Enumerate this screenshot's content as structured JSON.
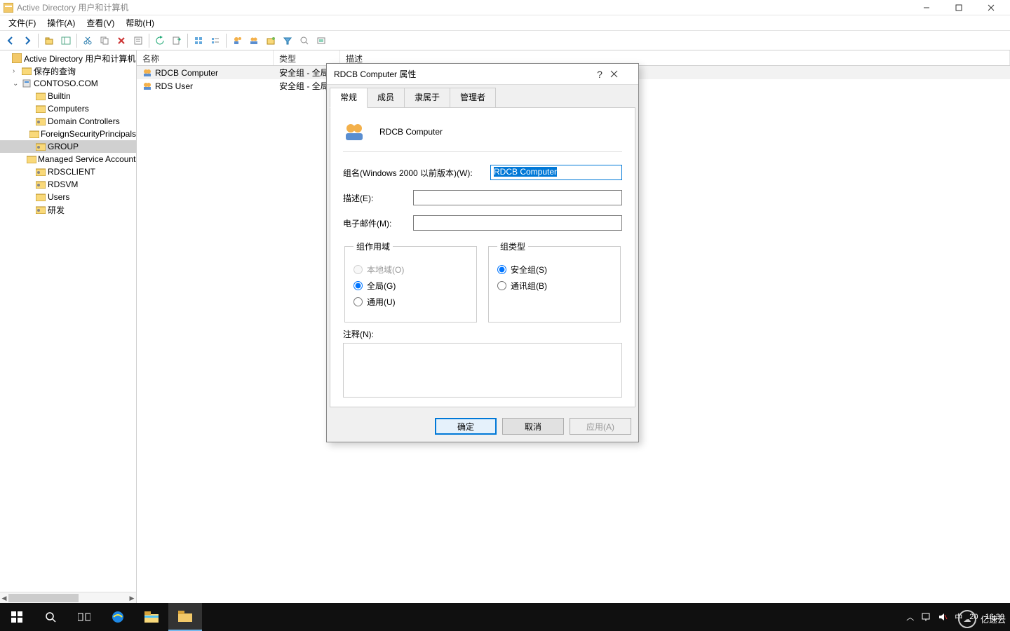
{
  "window": {
    "title": "Active Directory 用户和计算机",
    "min_tooltip": "最小化",
    "max_tooltip": "最大化",
    "close_tooltip": "关闭"
  },
  "menu": {
    "file": "文件(F)",
    "action": "操作(A)",
    "view": "查看(V)",
    "help": "帮助(H)"
  },
  "toolbar_icons": {
    "back": "←",
    "forward": "→",
    "up": "folder-up",
    "show_pane": "pane",
    "cut": "✂",
    "copy": "copy",
    "delete": "✖",
    "props": "props",
    "refresh": "⟳",
    "export": "export",
    "grid1": "g1",
    "grid2": "g2",
    "user_add": "ua",
    "group_add": "ga",
    "ou_add": "oa",
    "filter": "filter",
    "find": "find",
    "sort": "sort"
  },
  "tree": {
    "root": "Active Directory 用户和计算机",
    "saved_queries": "保存的查询",
    "domain": "CONTOSO.COM",
    "nodes": [
      {
        "label": "Builtin"
      },
      {
        "label": "Computers"
      },
      {
        "label": "Domain Controllers"
      },
      {
        "label": "ForeignSecurityPrincipals"
      },
      {
        "label": "GROUP",
        "selected": true
      },
      {
        "label": "Managed Service Accounts"
      },
      {
        "label": "RDSCLIENT"
      },
      {
        "label": "RDSVM"
      },
      {
        "label": "Users"
      },
      {
        "label": "研发"
      }
    ]
  },
  "list": {
    "headers": {
      "name": "名称",
      "type": "类型",
      "desc": "描述"
    },
    "rows": [
      {
        "name": "RDCB Computer",
        "type": "安全组 - 全局",
        "selected": true
      },
      {
        "name": "RDS User",
        "type": "安全组 - 全局"
      }
    ]
  },
  "dialog": {
    "title": "RDCB Computer 属性",
    "help": "?",
    "tabs": {
      "general": "常规",
      "members": "成员",
      "memberof": "隶属于",
      "managedby": "管理者"
    },
    "group_display_name": "RDCB Computer",
    "label_groupname": "组名(Windows 2000 以前版本)(W):",
    "value_groupname": "RDCB Computer",
    "label_desc": "描述(E):",
    "value_desc": "",
    "label_email": "电子邮件(M):",
    "value_email": "",
    "fieldset_scope": "组作用域",
    "scope_local": "本地域(O)",
    "scope_global": "全局(G)",
    "scope_universal": "通用(U)",
    "fieldset_type": "组类型",
    "type_security": "安全组(S)",
    "type_distribution": "通讯组(B)",
    "label_notes": "注释(N):",
    "value_notes": "",
    "btn_ok": "确定",
    "btn_cancel": "取消",
    "btn_apply": "应用(A)"
  },
  "taskbar": {
    "time": "16:30",
    "date_short": "20",
    "ime": "中",
    "watermark": "亿速云"
  }
}
